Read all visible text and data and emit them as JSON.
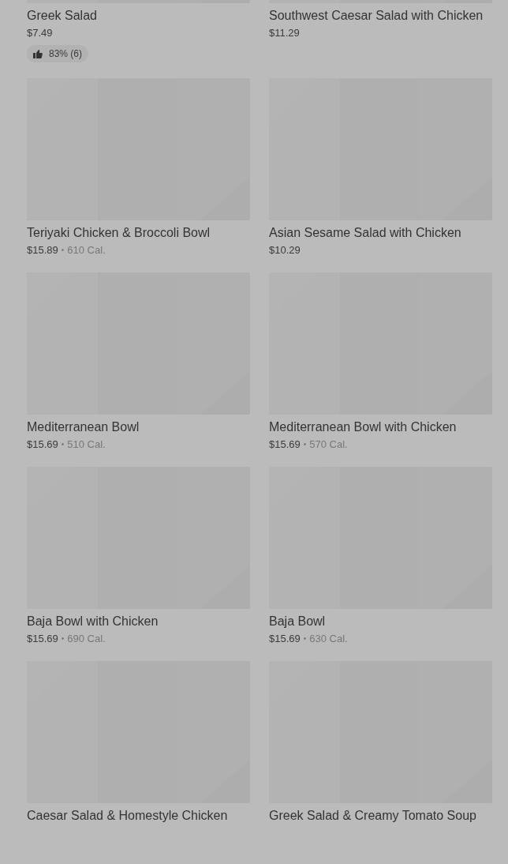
{
  "items": [
    {
      "name": "Greek Salad",
      "price": "$7.49",
      "rating": "83% (6)"
    },
    {
      "name": "Southwest Caesar Salad with Chicken",
      "price": "$11.29"
    },
    {
      "name": "Teriyaki Chicken & Broccoli Bowl",
      "price": "$15.89",
      "separator": "•",
      "calories": "610 Cal."
    },
    {
      "name": "Asian Sesame Salad with Chicken",
      "price": "$10.29"
    },
    {
      "name": "Mediterranean Bowl",
      "price": "$15.69",
      "separator": "•",
      "calories": "510 Cal."
    },
    {
      "name": "Mediterranean Bowl with Chicken",
      "price": "$15.69",
      "separator": "•",
      "calories": "570 Cal."
    },
    {
      "name": "Baja Bowl with Chicken",
      "price": "$15.69",
      "separator": "•",
      "calories": "690 Cal."
    },
    {
      "name": "Baja Bowl",
      "price": "$15.69",
      "separator": "•",
      "calories": "630 Cal."
    },
    {
      "name": "Caesar Salad & Homestyle Chicken"
    },
    {
      "name": "Greek Salad & Creamy Tomato Soup"
    }
  ]
}
